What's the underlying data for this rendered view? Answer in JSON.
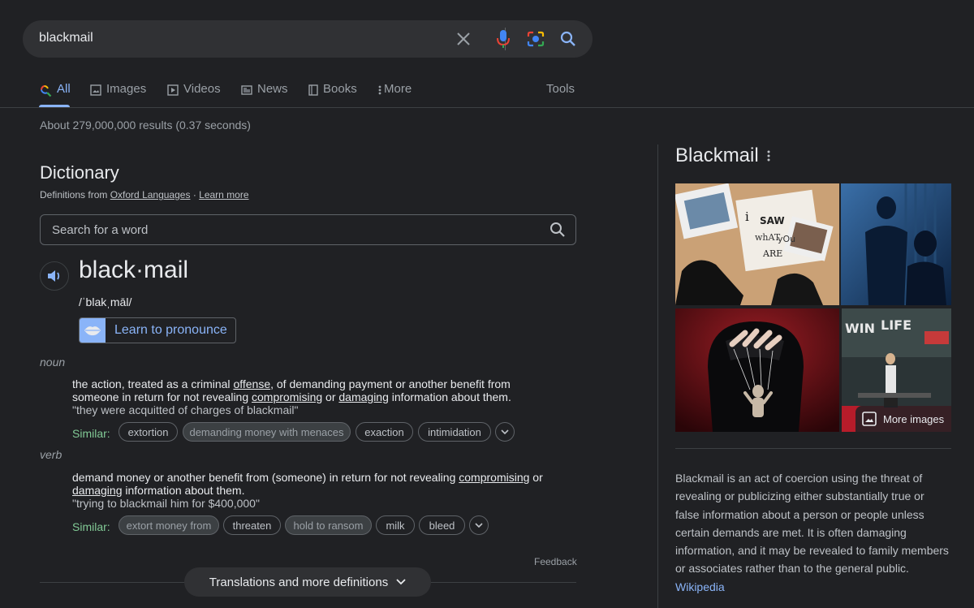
{
  "search": {
    "query": "blackmail"
  },
  "tabs": [
    {
      "label": "All",
      "icon": "google-multicolor-search-icon"
    },
    {
      "label": "Images",
      "icon": "image-icon"
    },
    {
      "label": "Videos",
      "icon": "play-icon"
    },
    {
      "label": "News",
      "icon": "news-icon"
    },
    {
      "label": "Books",
      "icon": "book-icon"
    },
    {
      "label": "More",
      "icon": "vertical-dots-icon"
    }
  ],
  "tools_label": "Tools",
  "result_stats": "About 279,000,000 results (0.37 seconds)",
  "dictionary": {
    "title": "Dictionary",
    "source_prefix": "Definitions from",
    "source_name": "Oxford Languages",
    "source_sep": "·",
    "learn_more": "Learn more",
    "search_placeholder": "Search for a word",
    "headword": "black·mail",
    "phonetic": "/ˈblakˌmāl/",
    "learn_to_pronounce": "Learn to pronounce",
    "senses": [
      {
        "pos": "noun",
        "def_parts": [
          "the action, treated as a criminal ",
          "offense",
          ", of demanding payment or another benefit from someone in return for not revealing ",
          "compromising",
          " or ",
          "damaging",
          " information about them."
        ],
        "example": "\"they were acquitted of charges of blackmail\"",
        "similar_label": "Similar:",
        "similar": [
          "extortion",
          "demanding money with menaces",
          "exaction",
          "intimidation"
        ]
      },
      {
        "pos": "verb",
        "def_parts": [
          "demand money or another benefit from (someone) in return for not revealing ",
          "compromising",
          " or ",
          "damaging",
          " information about them."
        ],
        "example": "\"trying to blackmail him for $400,000\"",
        "similar_label": "Similar:",
        "similar": [
          "extort money from",
          "threaten",
          "hold to ransom",
          "milk",
          "bleed"
        ]
      }
    ],
    "feedback": "Feedback",
    "more_definitions": "Translations and more definitions"
  },
  "knowledge_panel": {
    "title": "Blackmail",
    "image_texts": {
      "collage": [
        "i",
        "SAW",
        "whAT",
        "yOu",
        "ARE"
      ],
      "poster": [
        "WIN",
        "LIFE"
      ]
    },
    "more_images": "More images",
    "description": "Blackmail is an act of coercion using the threat of revealing or publicizing either substantially true or false information about a person or people unless certain demands are met. It is often damaging information, and it may be revealed to family members or associates rather than to the general public.",
    "source_link": "Wikipedia"
  },
  "colors": {
    "background": "#202124",
    "accent": "#8ab4f8",
    "similar_green": "#81c995"
  }
}
